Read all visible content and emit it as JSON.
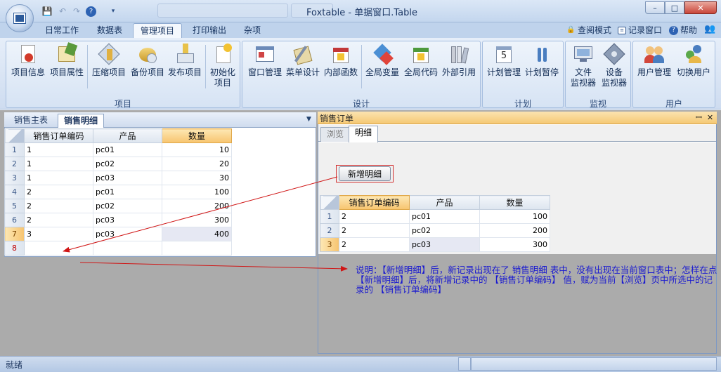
{
  "window": {
    "title": "Foxtable - 单据窗口.Table",
    "controls": {
      "min": "–",
      "max": "□",
      "close": "✕"
    }
  },
  "qat": {
    "save_icon": "save-icon",
    "undo_icon": "undo-icon",
    "redo_icon": "redo-icon",
    "help_icon": "help-icon"
  },
  "menu": {
    "tabs": [
      "日常工作",
      "数据表",
      "管理项目",
      "打印输出",
      "杂项"
    ],
    "active": "管理项目",
    "right_links": [
      {
        "icon": "lock-icon",
        "label": "查阅模式"
      },
      {
        "icon": "log-window-icon",
        "label": "记录窗口"
      },
      {
        "icon": "help-icon",
        "label": "帮助"
      }
    ]
  },
  "ribbon": {
    "groups": [
      {
        "label": "项目",
        "buttons": [
          "项目信息",
          "项目属性",
          "压缩项目",
          "备份项目",
          "发布项目",
          "初始化\n项目"
        ]
      },
      {
        "label": "设计",
        "buttons": [
          "窗口管理",
          "菜单设计",
          "内部函数",
          "全局变量",
          "全局代码",
          "外部引用"
        ]
      },
      {
        "label": "计划",
        "buttons": [
          "计划管理",
          "计划暂停"
        ]
      },
      {
        "label": "监视",
        "buttons": [
          "文件\n监视器",
          "设备\n监视器"
        ]
      },
      {
        "label": "用户",
        "buttons": [
          "用户管理",
          "切换用户"
        ]
      }
    ]
  },
  "left_panel": {
    "tabs": [
      "销售主表",
      "销售明细"
    ],
    "active_tab": "销售明细",
    "columns": [
      "销售订单编码",
      "产品",
      "数量"
    ],
    "rows": [
      {
        "n": "1",
        "code": "1",
        "product": "pc01",
        "qty": "10"
      },
      {
        "n": "2",
        "code": "1",
        "product": "pc02",
        "qty": "20"
      },
      {
        "n": "3",
        "code": "1",
        "product": "pc03",
        "qty": "30"
      },
      {
        "n": "4",
        "code": "2",
        "product": "pc01",
        "qty": "100"
      },
      {
        "n": "5",
        "code": "2",
        "product": "pc02",
        "qty": "200"
      },
      {
        "n": "6",
        "code": "2",
        "product": "pc03",
        "qty": "300"
      },
      {
        "n": "7",
        "code": "3",
        "product": "pc03",
        "qty": "400"
      },
      {
        "n": "8",
        "code": "",
        "product": "",
        "qty": ""
      }
    ]
  },
  "right_panel": {
    "title": "销售订单",
    "pin": "ꟷ",
    "close": "✕",
    "tabs": [
      "浏览",
      "明细"
    ],
    "active_tab": "明细",
    "add_button": "新增明细",
    "columns": [
      "销售订单编码",
      "产品",
      "数量"
    ],
    "rows": [
      {
        "n": "1",
        "code": "2",
        "product": "pc01",
        "qty": "100"
      },
      {
        "n": "2",
        "code": "2",
        "product": "pc02",
        "qty": "200"
      },
      {
        "n": "3",
        "code": "2",
        "product": "pc03",
        "qty": "300"
      }
    ]
  },
  "note": "说明：【新增明细】后，新记录出现在了 销售明细 表中，没有出现在当前窗口表中；怎样在点【新增明细】后，将新增记录中的 【销售订单编码】 值，赋为当前【浏览】页中所选中的记录的 【销售订单编码】",
  "status": {
    "text": "就绪"
  },
  "colors": {
    "accent": "#f7c46f",
    "arrow": "#d01515",
    "note_text": "#1a1ad0",
    "workspace": "#ababab"
  }
}
